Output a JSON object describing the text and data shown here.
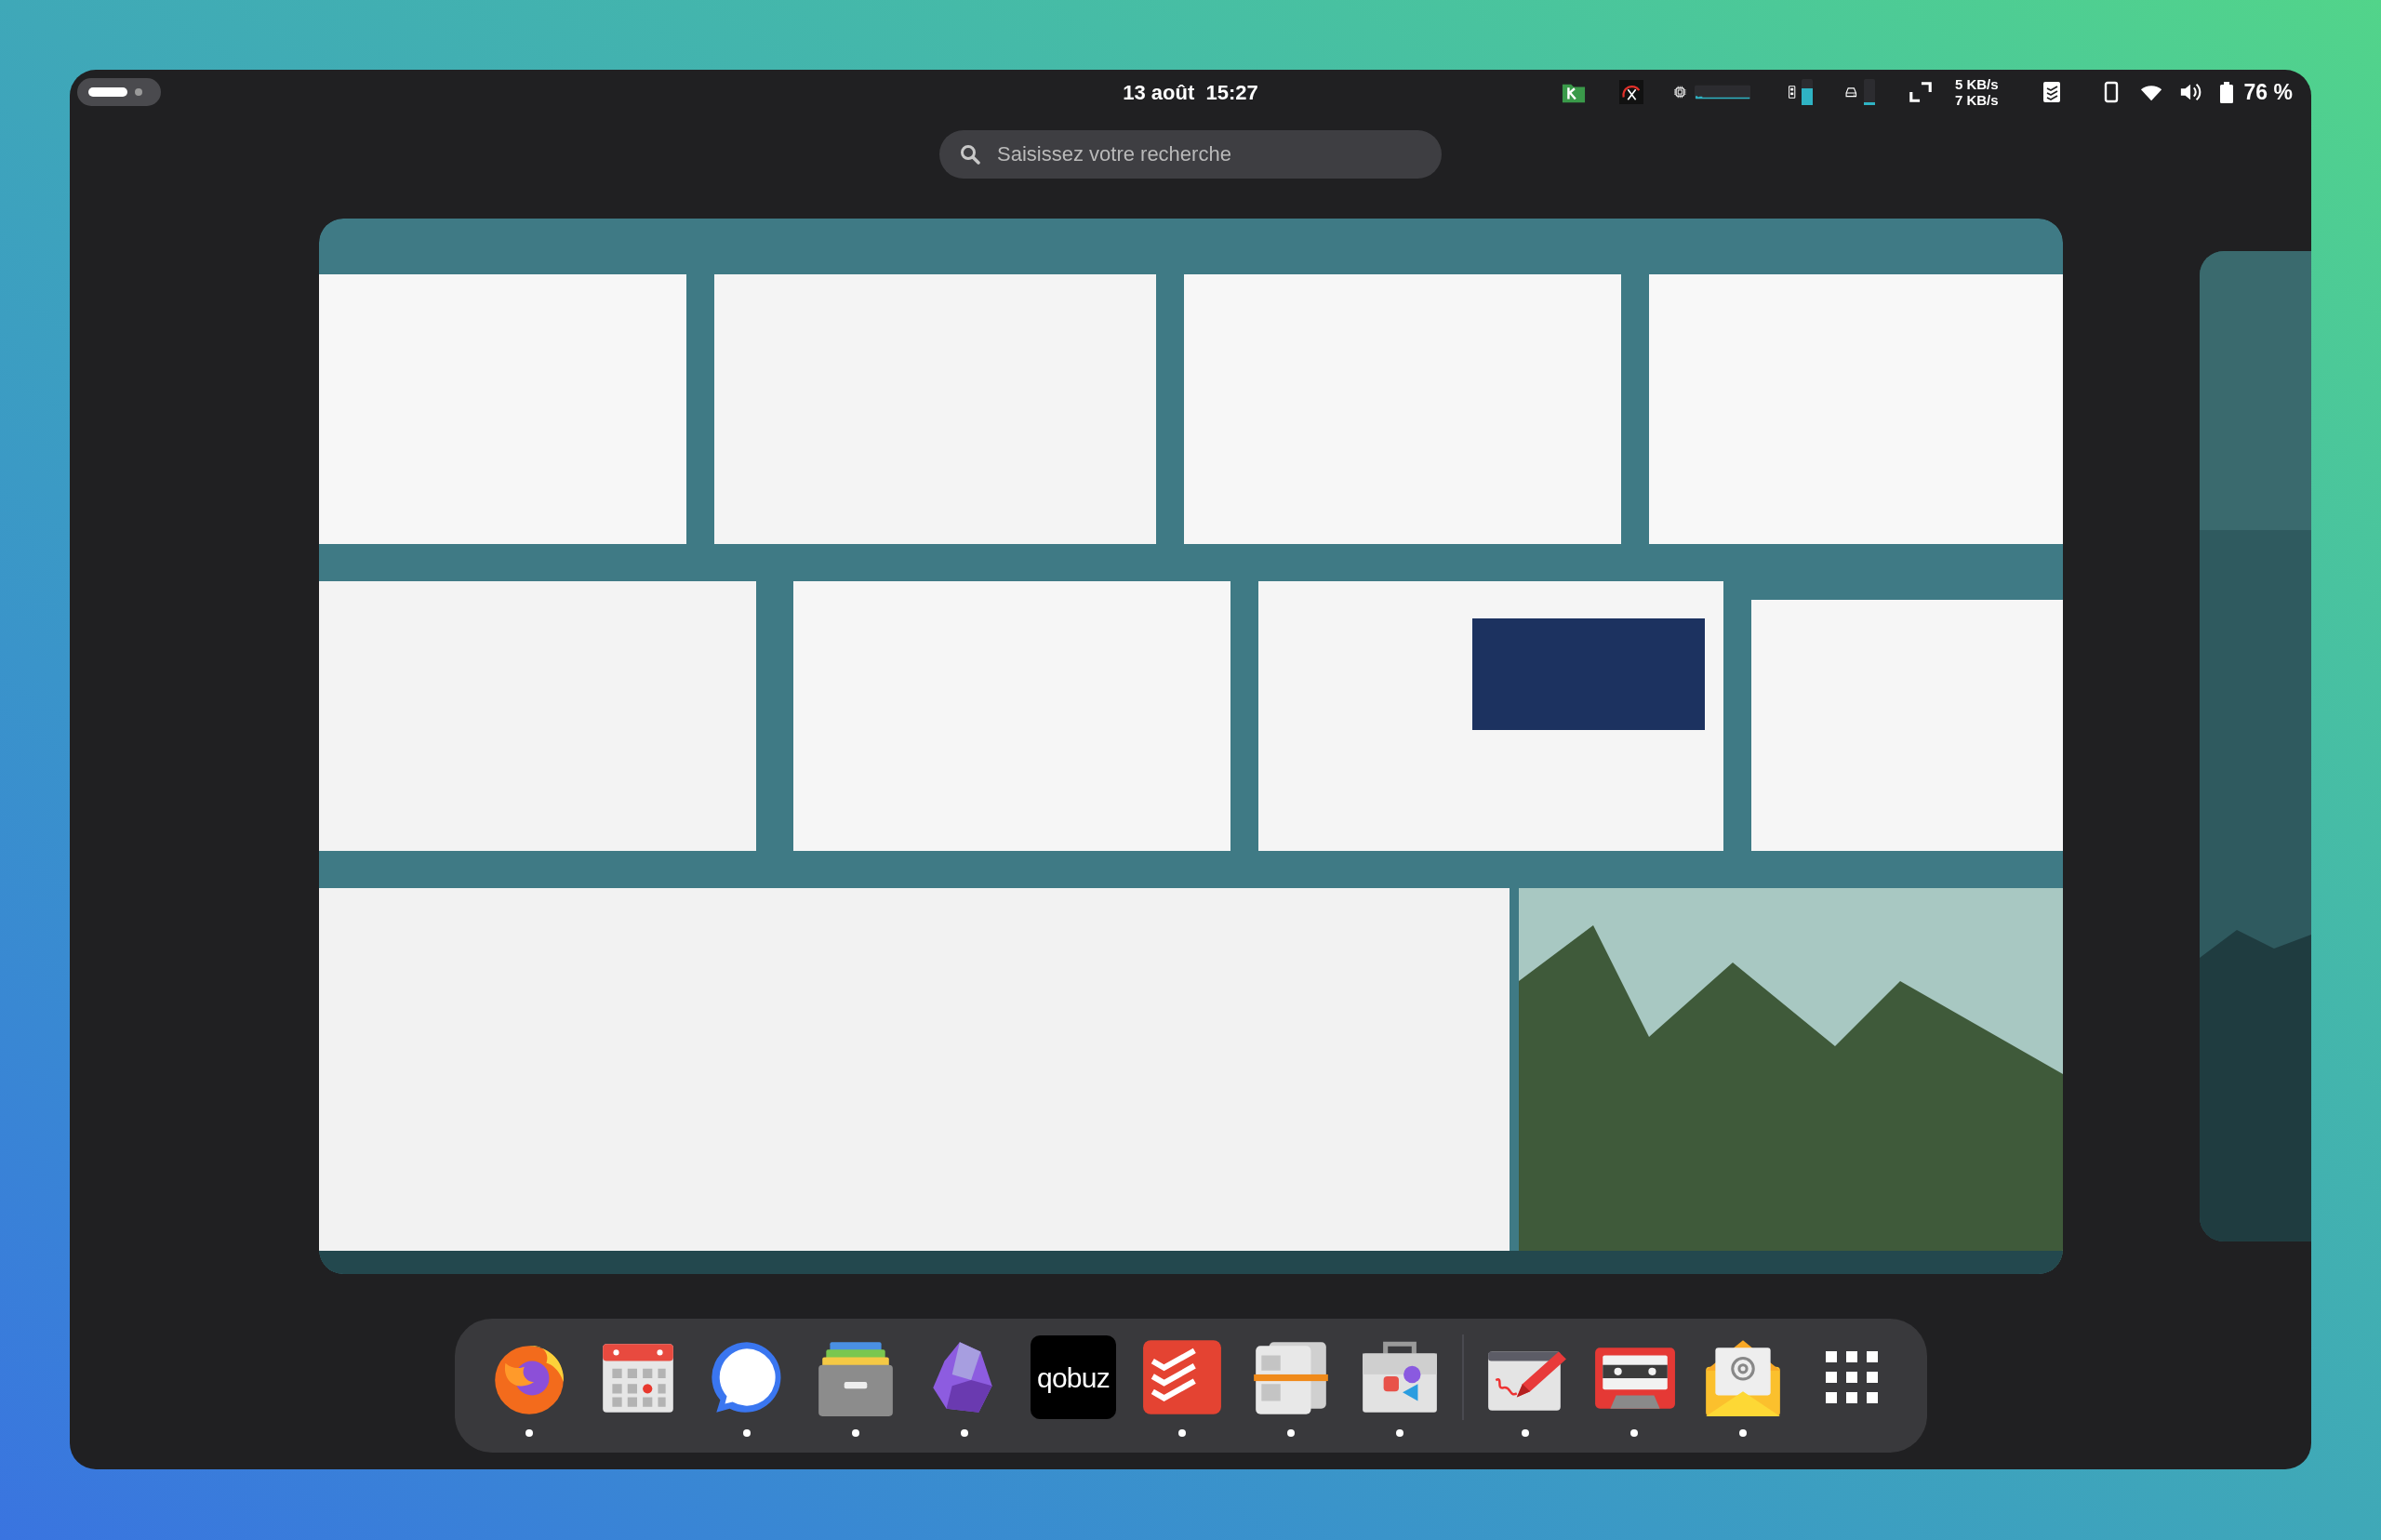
{
  "top_bar": {
    "clock": "13 août  15:27",
    "memory_meter": {
      "level": 0.65
    },
    "disk_meter": {
      "level": 0.1
    },
    "network_speed": [
      "5 KB/s",
      "7 KB/s"
    ],
    "battery": "76 %"
  },
  "search": {
    "placeholder": "Saisissez votre recherche"
  },
  "dock": {
    "apps": [
      {
        "running": true
      },
      {
        "running": false
      },
      {
        "running": true
      },
      {
        "running": true
      },
      {
        "running": true
      },
      {
        "running": false,
        "label": "qobuz"
      },
      {
        "running": true
      },
      {
        "running": true
      },
      {
        "running": true
      }
    ],
    "other_apps": [
      {
        "running": true
      },
      {
        "running": true
      },
      {
        "running": true
      }
    ]
  }
}
